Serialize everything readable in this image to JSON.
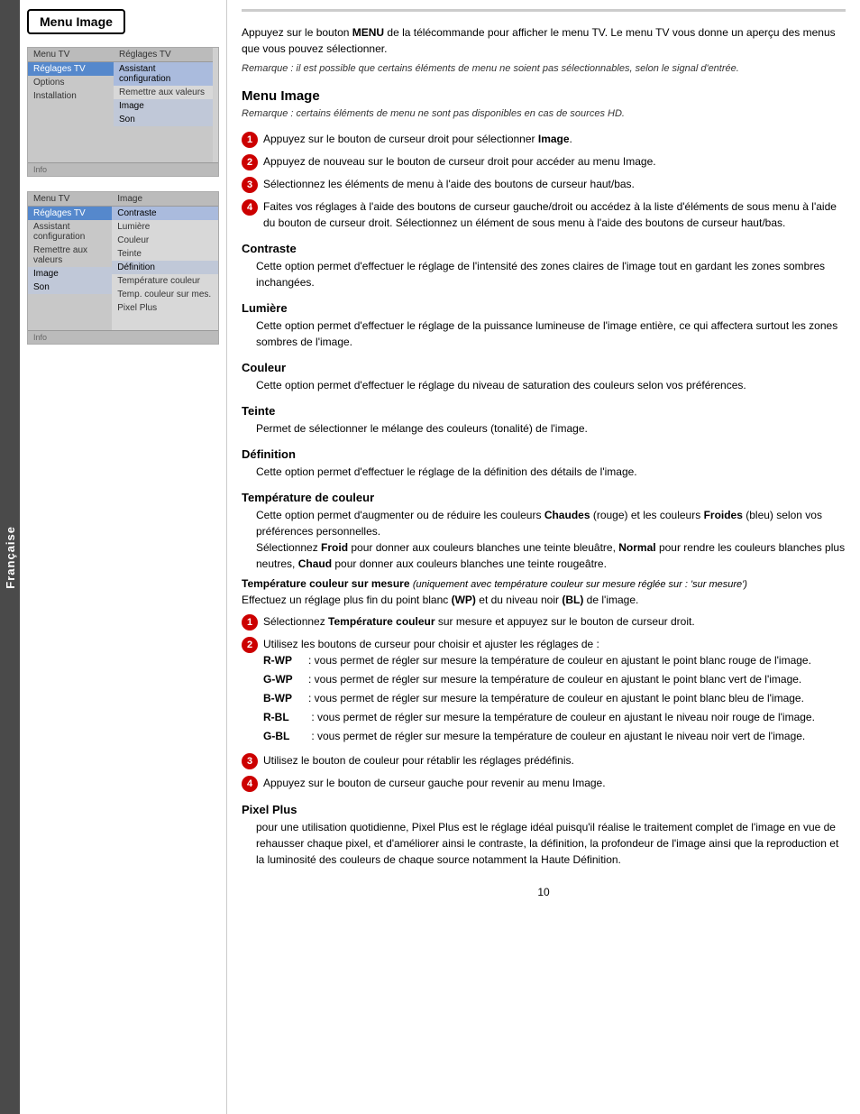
{
  "sidebar": {
    "label": "Française"
  },
  "header": {
    "menu_title": "Menu Image"
  },
  "intro": {
    "text": "Appuyez sur le bouton MENU de la télécommande pour afficher le menu TV. Le menu TV vous donne un aperçu des menus que vous pouvez sélectionner.",
    "note": "Remarque : il est possible que certains éléments de menu ne soient pas sélectionnables, selon le signal d'entrée.",
    "menu_bold": "MENU"
  },
  "menu_image_section": {
    "title": "Menu Image",
    "note": "Remarque : certains éléments de menu ne sont pas disponibles en cas de sources HD.",
    "steps": [
      {
        "num": "1",
        "text": "Appuyez sur le bouton de curseur droit pour sélectionner ",
        "bold": "Image",
        "after": "."
      },
      {
        "num": "2",
        "text": "Appuyez de nouveau sur le bouton de curseur droit pour accéder au menu Image."
      },
      {
        "num": "3",
        "text": "Sélectionnez les éléments de menu à l'aide des boutons de curseur haut/bas."
      },
      {
        "num": "4",
        "text": "Faites vos réglages à l'aide des boutons de curseur gauche/droit ou accédez à la liste d'éléments de sous menu à l'aide du bouton de curseur droit. Sélectionnez un élément de sous menu à l'aide des boutons de curseur haut/bas."
      }
    ]
  },
  "subsections": [
    {
      "title": "Contraste",
      "body": "Cette option permet d'effectuer le réglage de l'intensité des zones claires de l'image tout en gardant les zones sombres inchangées."
    },
    {
      "title": "Lumière",
      "body": "Cette option permet d'effectuer le réglage de la puissance lumineuse de l'image entière, ce qui affectera surtout les zones sombres de l'image."
    },
    {
      "title": "Couleur",
      "body": "Cette option permet d'effectuer le réglage du niveau de saturation des couleurs selon vos préférences."
    },
    {
      "title": "Teinte",
      "body": "Permet de sélectionner le mélange des couleurs (tonalité) de l'image."
    },
    {
      "title": "Définition",
      "body": "Cette option permet d'effectuer le réglage de la définition des détails de l'image."
    },
    {
      "title": "Température de couleur",
      "body": "Cette option permet d'augmenter ou de réduire les couleurs Chaudes (rouge) et les couleurs Froides (bleu) selon vos préférences personnelles. Sélectionnez Froid pour donner aux couleurs blanches une teinte bleuâtre, Normal pour rendre les couleurs blanches plus neutres, Chaud pour donner aux couleurs blanches une teinte rougeâtre."
    }
  ],
  "temp_mesure_section": {
    "title": "Température couleur sur mesure",
    "italic_note": "(uniquement avec température couleur sur mesure réglée sur : 'sur mesure')",
    "intro": "Effectuez un réglage plus fin du point blanc (WP) et du niveau noir (BL) de l'image.",
    "steps": [
      {
        "num": "1",
        "text": "Sélectionnez Température couleur sur mesure et appuyez sur le bouton de curseur droit."
      },
      {
        "num": "2",
        "text": "Utilisez les boutons de curseur pour choisir et ajuster les réglages de :",
        "bullets": [
          {
            "label": "R-WP",
            "text": ": vous permet de régler sur mesure la température de couleur en ajustant le point blanc rouge de l'image."
          },
          {
            "label": "G-WP",
            "text": ": vous permet de régler sur mesure la température de couleur en ajustant le point blanc vert de l'image."
          },
          {
            "label": "B-WP",
            "text": ": vous permet de régler sur mesure la température de couleur en ajustant le point blanc bleu de l'image."
          },
          {
            "label": "R-BL",
            "text": " : vous permet de régler sur mesure la température de couleur en ajustant le niveau noir rouge de l'image."
          },
          {
            "label": "G-BL",
            "text": " : vous permet de régler sur mesure la température de couleur en ajustant le niveau noir vert de l'image."
          }
        ]
      },
      {
        "num": "3",
        "text": "Utilisez le bouton de couleur pour rétablir les réglages prédéfinis."
      },
      {
        "num": "4",
        "text": "Appuyez sur le bouton de curseur gauche pour revenir au menu Image."
      }
    ]
  },
  "pixel_plus_section": {
    "title": "Pixel Plus",
    "body": "pour une utilisation quotidienne, Pixel Plus est le réglage idéal puisqu'il réalise le traitement complet de l'image en vue de rehausser chaque pixel, et d'améliorer ainsi le contraste, la définition, la profondeur de l'image ainsi que la reproduction et la luminosité des couleurs de chaque source notamment la Haute Définition."
  },
  "page_number": "10",
  "tv_menu1": {
    "header_left": "Menu TV",
    "header_right": "Réglages TV",
    "items_left": [
      "Réglages TV",
      "Options",
      "Installation",
      "",
      "",
      "",
      "",
      ""
    ],
    "items_right": [
      "Assistant configuration",
      "Remettre aux valeurs",
      "Image",
      "Son",
      "",
      "",
      "",
      ""
    ],
    "highlight_left": "Réglages TV",
    "highlight_right": "Assistant configuration",
    "footer": "Info"
  },
  "tv_menu2": {
    "header_left": "Menu TV",
    "items_left": [
      "Réglages TV",
      "Assistant configuration",
      "Remettre aux valeurs",
      "Image",
      "Son",
      "",
      "",
      "",
      ""
    ],
    "items_right": [
      "Image",
      "Contraste",
      "Lumière",
      "Couleur",
      "Teinte",
      "Définition",
      "Température couleur",
      "Temp. couleur sur mes.",
      "Pixel Plus"
    ],
    "highlight_left_items": [
      "Réglages TV"
    ],
    "highlight_left2": "Image",
    "footer": "Info"
  }
}
